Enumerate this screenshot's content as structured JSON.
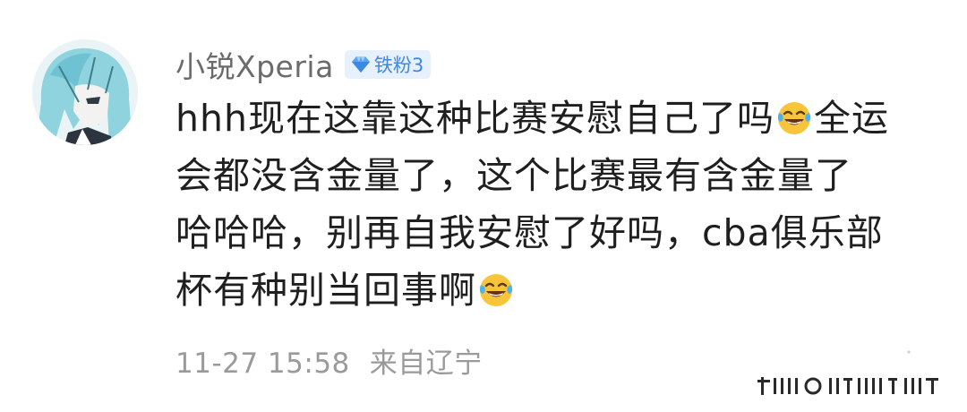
{
  "comment": {
    "username": "小锐Xperia",
    "badge": {
      "icon": "diamond-icon",
      "label": "铁粉3",
      "color": "#3d88e3"
    },
    "content_lines": [
      "hhh现在这靠这种比赛安慰自己了吗",
      "全运",
      "会都没含金量了，这个比赛最有含金量了",
      "哈哈哈，别再自我安慰了好吗，cba俱乐部",
      "杯有种别当回事啊"
    ],
    "emojis": [
      "laughing-tears-emoji",
      "laughing-tears-emoji"
    ],
    "timestamp": "11-27 15:58",
    "location": "来自辽宁"
  },
  "watermark_text": "头条 @"
}
